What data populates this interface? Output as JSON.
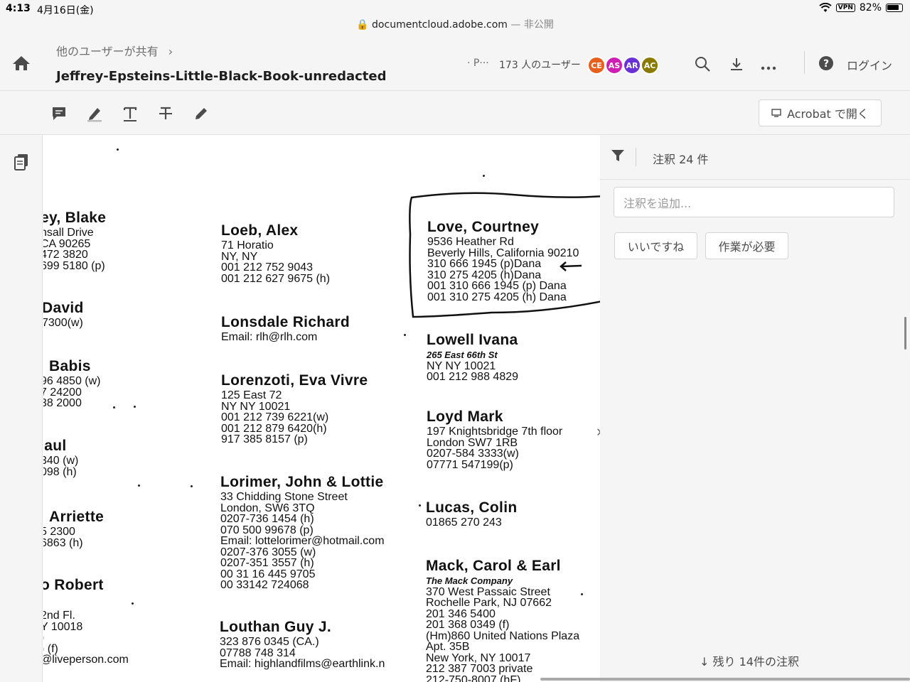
{
  "status_bar": {
    "time": "4:13",
    "date": "4月16日(金)",
    "url": "documentcloud.adobe.com",
    "visibility": "— 非公開",
    "vpn": "VPN",
    "battery": "82%"
  },
  "header": {
    "breadcrumb": "他のユーザーが共有",
    "title": "Jeffrey-Epsteins-Little-Black-Book-unredacted",
    "people_prefix": "· P···",
    "users_count": "173 人のユーザー",
    "avatars": [
      {
        "initials": "CE",
        "color": "#e8601c"
      },
      {
        "initials": "AS",
        "color": "#d01eb5"
      },
      {
        "initials": "AR",
        "color": "#6b2fd6"
      },
      {
        "initials": "AC",
        "color": "#8a7a00"
      }
    ],
    "login": "ログイン"
  },
  "toolbar": {
    "open_in_acrobat": "Acrobat で開く"
  },
  "comments_panel": {
    "count": "注釈 24 件",
    "add_placeholder": "注釈を追加...",
    "like": "いいですね",
    "needs_work": "作業が必要",
    "remaining": "残り 14件の注釈"
  },
  "document": {
    "col1": [
      {
        "name": "ey, Blake",
        "lines": [
          "nsall Drive",
          "CA 90265",
          "472 3820",
          "699 5180 (p)"
        ]
      },
      {
        "name": "David",
        "lines": [
          "7300(w)"
        ]
      },
      {
        "name": "Babis",
        "lines": [
          "96 4850 (w)",
          "7 24200",
          "38 2000"
        ]
      },
      {
        "name": "'aul",
        "lines": [
          "340 (w)",
          "098 (h)"
        ]
      },
      {
        "name": "Arriette",
        "lines": [
          "5 2300",
          "6863 (h)"
        ]
      },
      {
        "name": "o Robert",
        "lines": []
      },
      {
        "name": "",
        "lines": [
          "2nd Fl.",
          "Y 10018",
          ")",
          ") (f)",
          "@liveperson.com"
        ]
      }
    ],
    "col2": [
      {
        "name": "Loeb, Alex",
        "lines": [
          "71 Horatio",
          "NY, NY",
          "001 212 752 9043",
          "001 212 627 9675 (h)"
        ]
      },
      {
        "name": "Lonsdale Richard",
        "lines": [
          "Email: rlh@rlh.com"
        ]
      },
      {
        "name": "Lorenzoti, Eva Vivre",
        "lines": [
          "125 East 72",
          "NY NY 10021",
          "001 212 739 6221(w)",
          "001 212 879 6420(h)",
          "917 385 8157 (p)"
        ]
      },
      {
        "name": "Lorimer, John & Lottie",
        "lines": [
          "33 Chidding Stone Street",
          "London, SW6 3TQ",
          "0207-736 1454 (h)",
          "070 500 99678 (p)",
          "Email: lottelorimer@hotmail.com",
          "0207-376 3055 (w)",
          "0207-351 3557 (h)",
          "00 31 16 445 9705",
          "00 33142 724068"
        ]
      },
      {
        "name": "Louthan Guy J.",
        "lines": [
          "323 876 0345 (CA.)",
          "07788 748 314",
          "Email: highlandfilms@earthlink.n"
        ]
      }
    ],
    "col3": [
      {
        "name": "Love, Courtney",
        "lines": [
          "9536 Heather Rd",
          "Beverly Hills, California 90210",
          "310 666 1945 (p)Dana",
          "310 275 4205 (h)Dana",
          "001 310 666 1945 (p) Dana",
          "001 310 275 4205 (h) Dana"
        ]
      },
      {
        "name": "Lowell Ivana",
        "company": "265 East 66th St",
        "lines": [
          "NY NY 10021",
          "001 212 988 4829"
        ]
      },
      {
        "name": "Loyd Mark",
        "lines": [
          "197 Knightsbridge 7th floor",
          "London SW7 1RB",
          "0207-584 3333(w)",
          " 07771 547199(p)"
        ]
      },
      {
        "name": "Lucas, Colin",
        "lines": [
          "01865 270 243"
        ]
      },
      {
        "name": "Mack, Carol & Earl",
        "company": "The Mack Company",
        "lines": [
          "370 West Passaic Street",
          "Rochelle Park, NJ 07662",
          "201 346 5400",
          "201 368 0349 (f)",
          "(Hm)860 United Nations Plaza",
          "Apt. 35B",
          "New York, NY 10017",
          "212 387 7003 private",
          "212-750-8007 (hF)"
        ]
      }
    ]
  }
}
